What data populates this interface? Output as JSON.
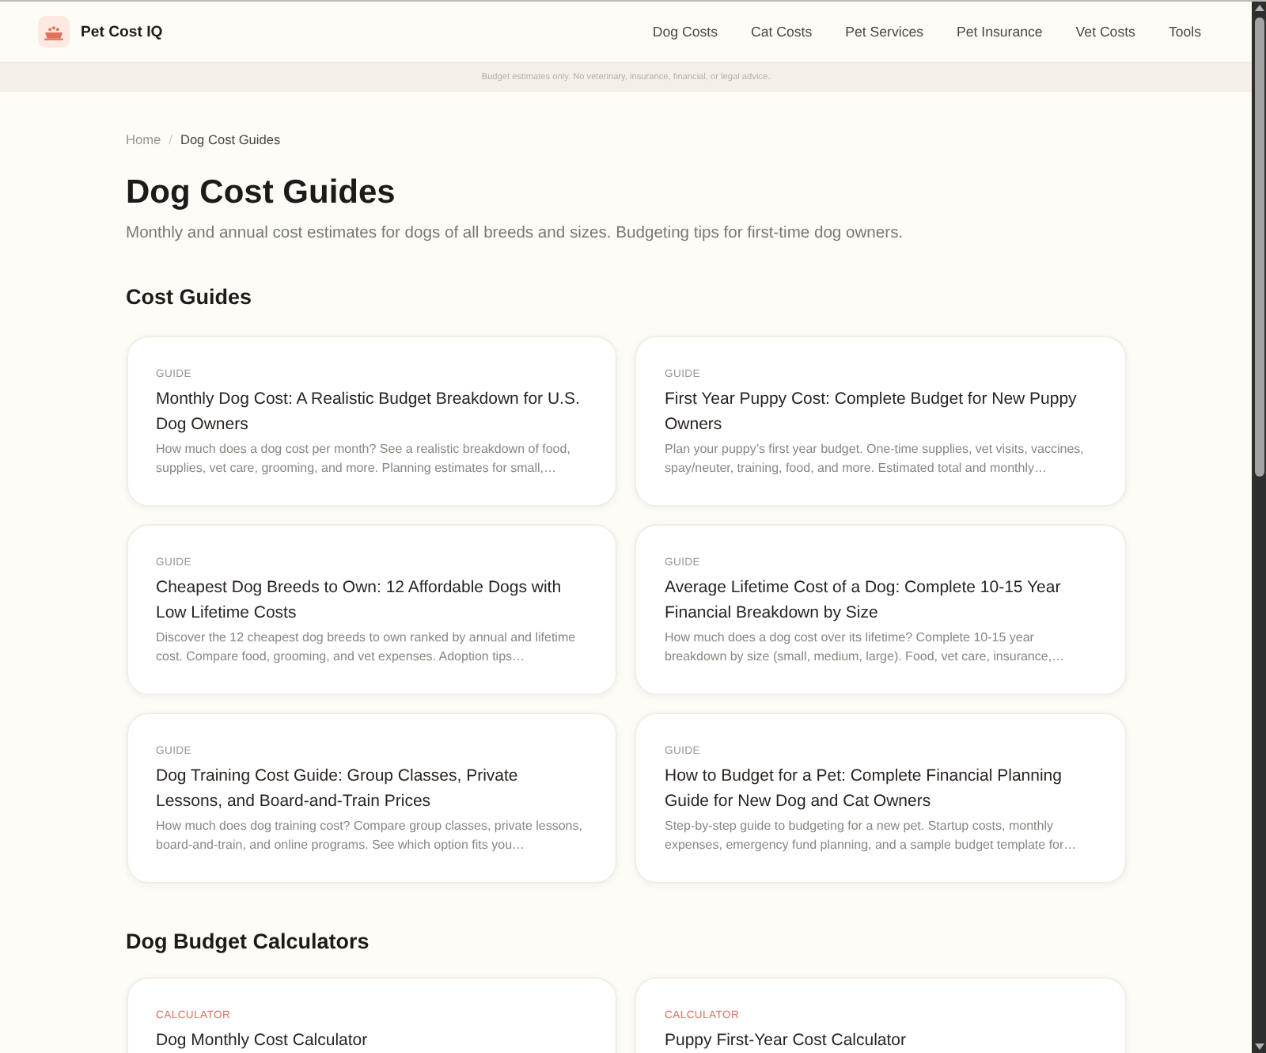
{
  "header": {
    "site_name": "Pet Cost IQ",
    "nav": [
      "Dog Costs",
      "Cat Costs",
      "Pet Services",
      "Pet Insurance",
      "Vet Costs",
      "Tools"
    ]
  },
  "disclaimer": "Budget estimates only. No veterinary, insurance, financial, or legal advice.",
  "breadcrumb": {
    "separator": "/",
    "items": [
      {
        "label": "Home",
        "current": false
      },
      {
        "label": "Dog Cost Guides",
        "current": true
      }
    ]
  },
  "page_title": "Dog Cost Guides",
  "intro": "Monthly and annual cost estimates for dogs of all breeds and sizes. Budgeting tips for first-time dog owners.",
  "sections": [
    {
      "heading": "Cost Guides",
      "cards": [
        {
          "kind": "guide",
          "tag": "GUIDE",
          "title": "Monthly Dog Cost: A Realistic Budget Breakdown for U.S. Dog Owners",
          "description": "How much does a dog cost per month? See a realistic breakdown of food, supplies, vet care, grooming, and more. Planning estimates for small,…"
        },
        {
          "kind": "guide",
          "tag": "GUIDE",
          "title": "First Year Puppy Cost: Complete Budget for New Puppy Owners",
          "description": "Plan your puppy’s first year budget. One-time supplies, vet visits, vaccines, spay/neuter, training, food, and more. Estimated total and monthly…"
        },
        {
          "kind": "guide",
          "tag": "GUIDE",
          "title": "Cheapest Dog Breeds to Own: 12 Affordable Dogs with Low Lifetime Costs",
          "description": "Discover the 12 cheapest dog breeds to own ranked by annual and lifetime cost. Compare food, grooming, and vet expenses. Adoption tips…"
        },
        {
          "kind": "guide",
          "tag": "GUIDE",
          "title": "Average Lifetime Cost of a Dog: Complete 10-15 Year Financial Breakdown by Size",
          "description": "How much does a dog cost over its lifetime? Complete 10-15 year breakdown by size (small, medium, large). Food, vet care, insurance,…"
        },
        {
          "kind": "guide",
          "tag": "GUIDE",
          "title": "Dog Training Cost Guide: Group Classes, Private Lessons, and Board-and-Train Prices",
          "description": "How much does dog training cost? Compare group classes, private lessons, board-and-train, and online programs. See which option fits you…"
        },
        {
          "kind": "guide",
          "tag": "GUIDE",
          "title": "How to Budget for a Pet: Complete Financial Planning Guide for New Dog and Cat Owners",
          "description": "Step-by-step guide to budgeting for a new pet. Startup costs, monthly expenses, emergency fund planning, and a sample budget template for…"
        }
      ]
    },
    {
      "heading": "Dog Budget Calculators",
      "cards": [
        {
          "kind": "calculator",
          "tag": "CALCULATOR",
          "title": "Dog Monthly Cost Calculator"
        },
        {
          "kind": "calculator",
          "tag": "CALCULATOR",
          "title": "Puppy First-Year Cost Calculator"
        }
      ]
    }
  ]
}
